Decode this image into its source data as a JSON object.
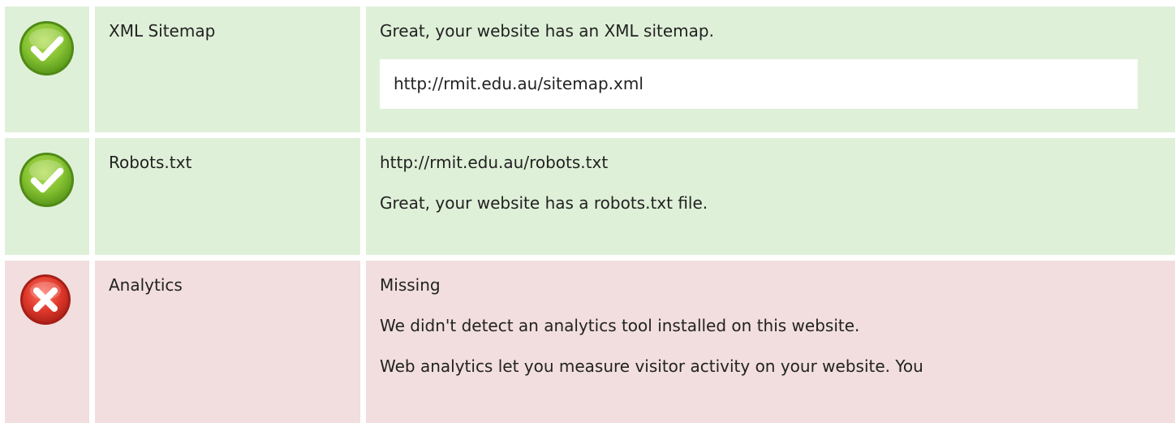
{
  "rows": [
    {
      "status": "pass",
      "label": "XML Sitemap",
      "message": "Great, your website has an XML sitemap.",
      "url": "http://rmit.edu.au/sitemap.xml"
    },
    {
      "status": "pass",
      "label": "Robots.txt",
      "url": "http://rmit.edu.au/robots.txt",
      "message": "Great, your website has a robots.txt file."
    },
    {
      "status": "fail",
      "label": "Analytics",
      "value": "Missing",
      "message": "We didn't detect an analytics tool installed on this website.",
      "detail": "Web analytics let you measure visitor activity on your website. You"
    }
  ],
  "icons": {
    "pass": "check-circle-icon",
    "fail": "x-circle-icon"
  },
  "colors": {
    "pass_background": "#dff0d8",
    "fail_background": "#f2dede",
    "pass_icon": "#76b82a",
    "fail_icon": "#dd3c2f",
    "url_box_background": "#ffffff",
    "text": "#222222"
  }
}
